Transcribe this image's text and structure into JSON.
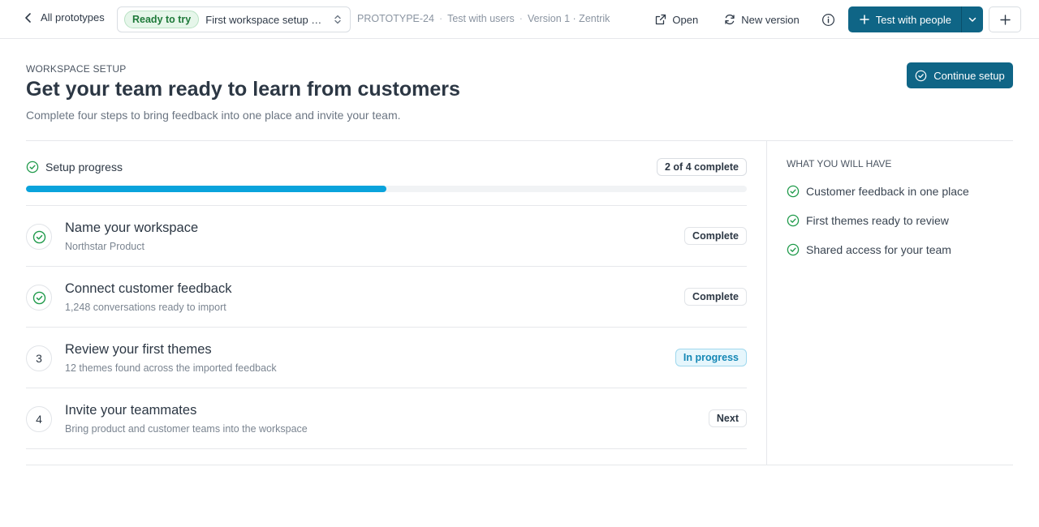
{
  "topbar": {
    "back_label": "All prototypes",
    "status": "Ready to try",
    "prototype_name": "First workspace setup ch...",
    "meta": {
      "id": "PROTOTYPE-24",
      "stage": "Test with users",
      "version": "Version 1 · Zentrik"
    },
    "open_label": "Open",
    "new_version_label": "New version",
    "test_label": "Test with people"
  },
  "header": {
    "eyebrow": "WORKSPACE SETUP",
    "title": "Get your team ready to learn from customers",
    "subtitle": "Complete four steps to bring feedback into one place and invite your team.",
    "continue_label": "Continue setup"
  },
  "progress": {
    "title": "Setup progress",
    "count_label": "2 of 4 complete",
    "fraction": 0.5
  },
  "steps": [
    {
      "marker": "",
      "done": true,
      "title": "Name your workspace",
      "description": "Northstar Product",
      "status": "Complete",
      "status_kind": "complete"
    },
    {
      "marker": "",
      "done": true,
      "title": "Connect customer feedback",
      "description": "1,248 conversations ready to import",
      "status": "Complete",
      "status_kind": "complete"
    },
    {
      "marker": "3",
      "done": false,
      "title": "Review your first themes",
      "description": "12 themes found across the imported feedback",
      "status": "In progress",
      "status_kind": "progress"
    },
    {
      "marker": "4",
      "done": false,
      "title": "Invite your teammates",
      "description": "Bring product and customer teams into the workspace",
      "status": "Next",
      "status_kind": "next"
    }
  ],
  "benefits": {
    "heading": "WHAT YOU WILL HAVE",
    "items": [
      "Customer feedback in one place",
      "First themes ready to review",
      "Shared access for your team"
    ]
  },
  "colors": {
    "primary": "#0f6586",
    "progress_fill": "#0aa3dc",
    "success": "#1f9a4a"
  }
}
